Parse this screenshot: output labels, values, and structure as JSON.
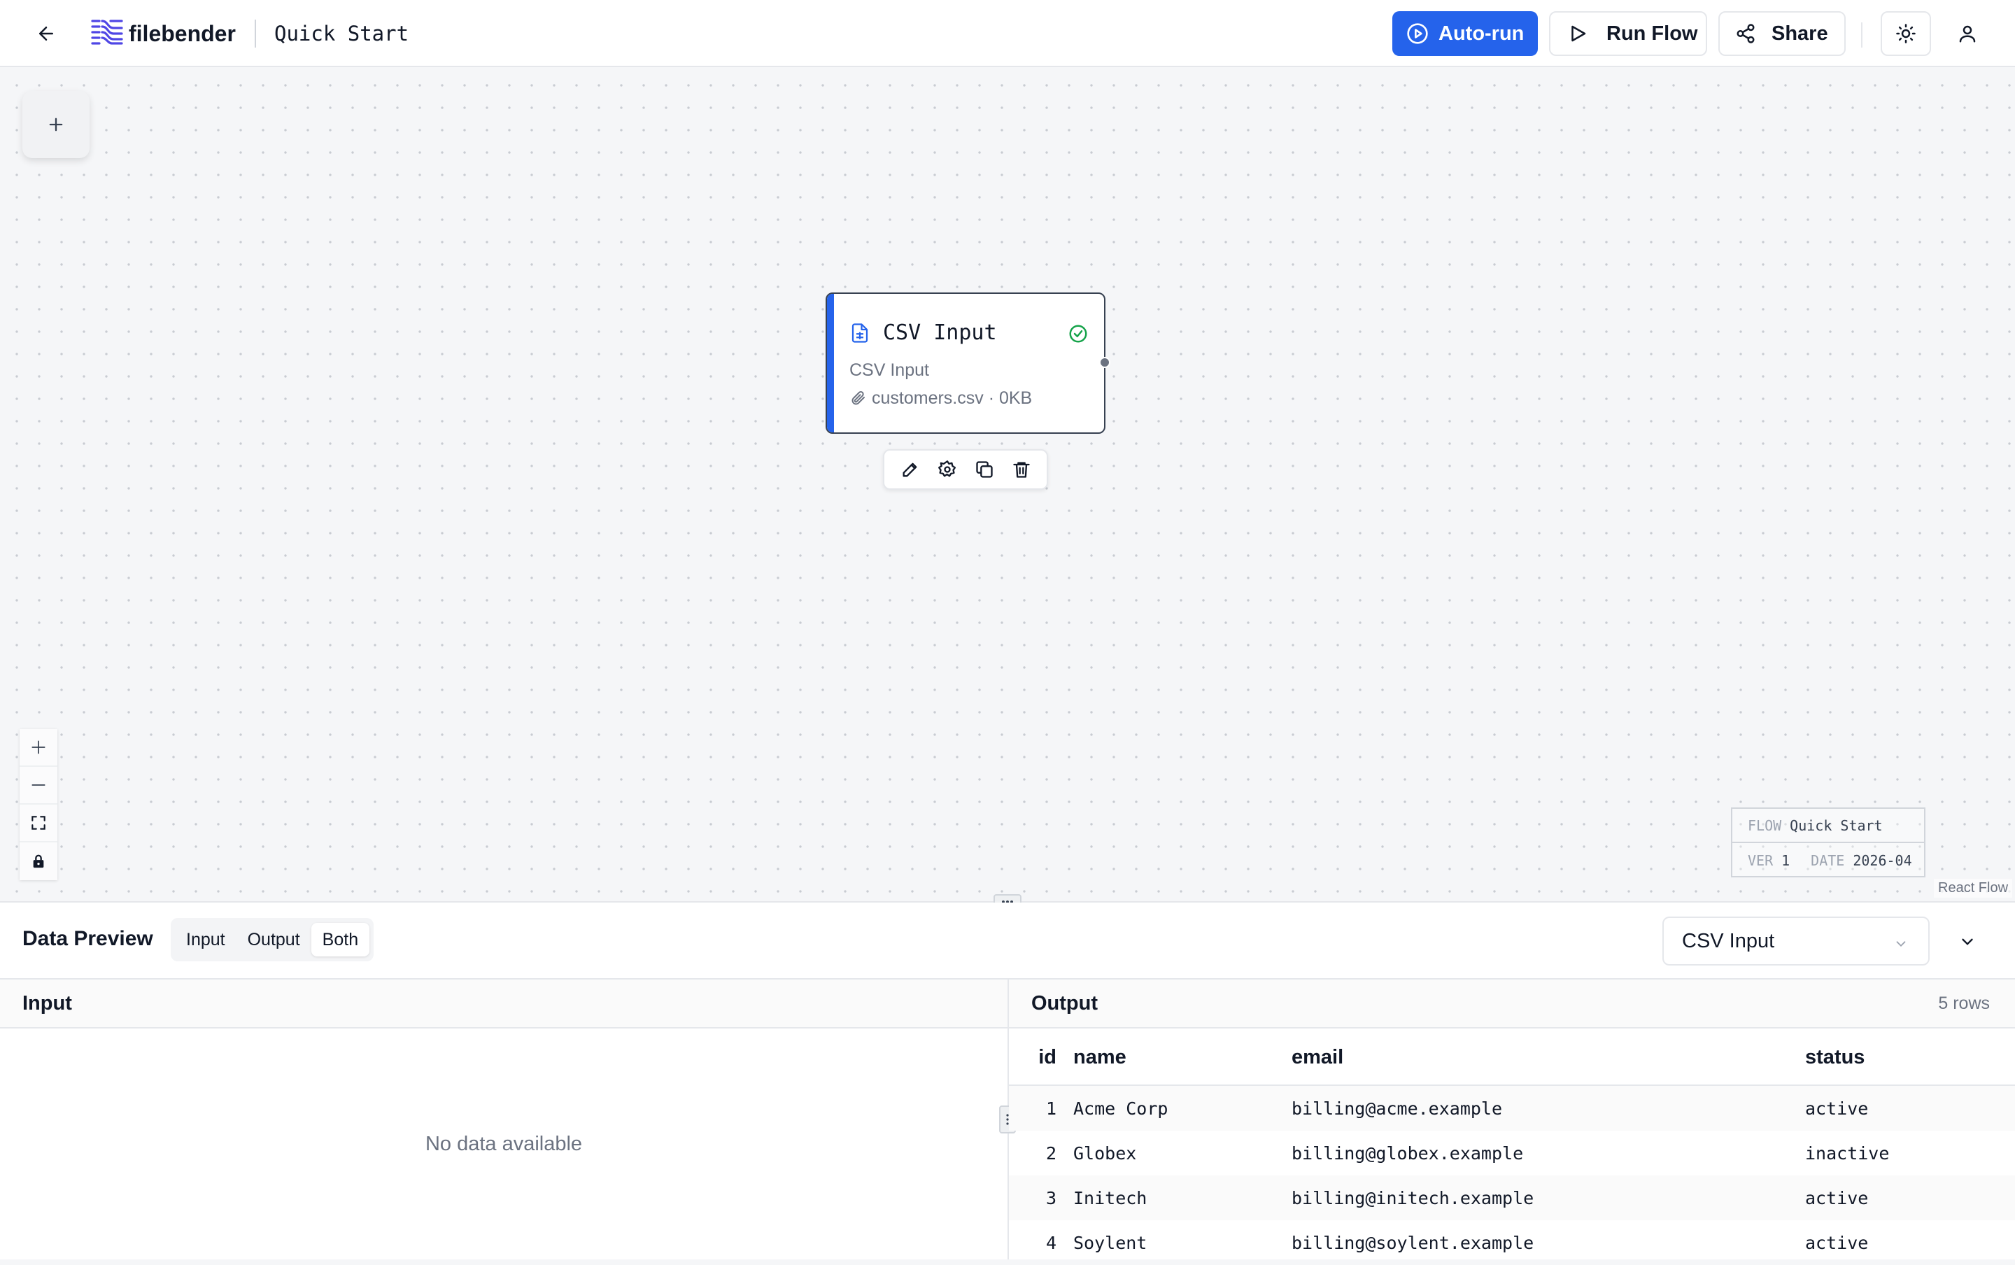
{
  "header": {
    "brand": "filebender",
    "flow_title": "Quick Start",
    "autorun_label": "Auto-run",
    "run_flow_label": "Run Flow",
    "share_label": "Share",
    "accent_color": "#2563eb"
  },
  "canvas": {
    "node": {
      "title": "CSV Input",
      "subtitle": "CSV Input",
      "file": "customers.csv · 0KB",
      "status": "success",
      "accent_color": "#2563eb"
    },
    "flow_info": {
      "flow_label": "FLOW",
      "flow_value": "Quick Start",
      "ver_label": "VER",
      "ver_value": "1",
      "date_label": "DATE",
      "date_value": "2026-04"
    },
    "attribution": "React Flow",
    "icons": [
      "plus-icon",
      "zoom-in-icon",
      "zoom-out-icon",
      "fit-view-icon",
      "lock-icon",
      "edit-icon",
      "settings-icon",
      "duplicate-icon",
      "delete-icon"
    ]
  },
  "preview": {
    "title": "Data Preview",
    "modes": [
      "Input",
      "Output",
      "Both"
    ],
    "active_mode": "Both",
    "selected_node": "CSV Input",
    "input_header": "Input",
    "input_empty": "No data available",
    "output_header": "Output",
    "row_count": "5 rows",
    "columns": [
      "id",
      "name",
      "email",
      "status"
    ],
    "rows": [
      {
        "id": "1",
        "name": "Acme Corp",
        "email": "billing@acme.example",
        "status": "active"
      },
      {
        "id": "2",
        "name": "Globex",
        "email": "billing@globex.example",
        "status": "inactive"
      },
      {
        "id": "3",
        "name": "Initech",
        "email": "billing@initech.example",
        "status": "active"
      },
      {
        "id": "4",
        "name": "Soylent",
        "email": "billing@soylent.example",
        "status": "active"
      }
    ]
  }
}
